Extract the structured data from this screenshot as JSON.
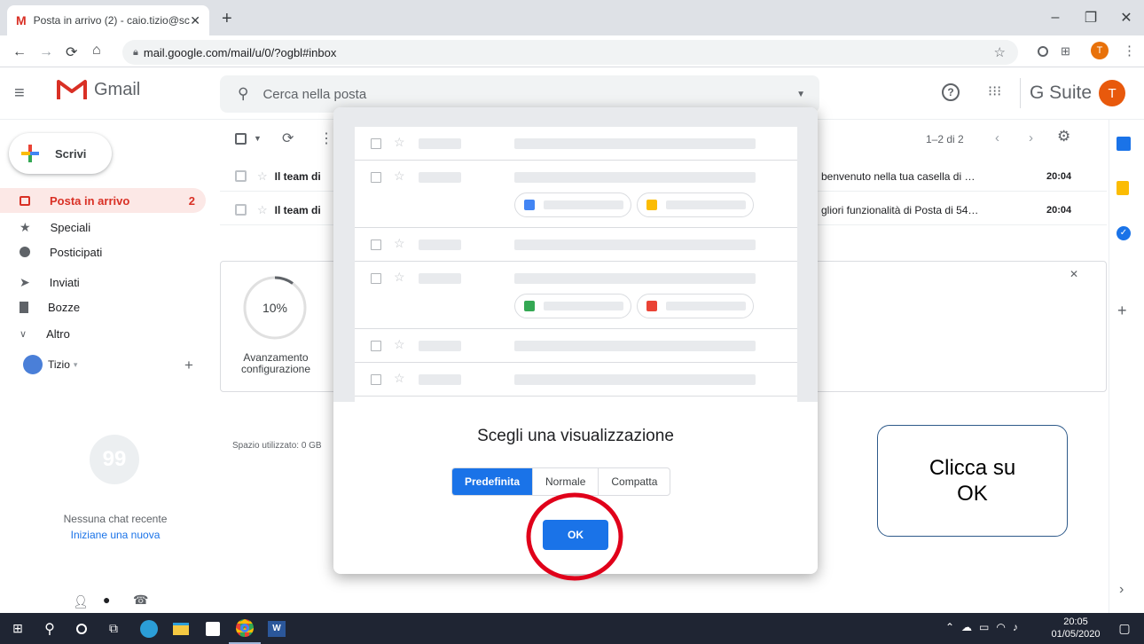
{
  "browser": {
    "tab_title": "Posta in arrivo (2) - caio.tizio@sc",
    "url": "mail.google.com/mail/u/0/?ogbl#inbox"
  },
  "gmail": {
    "logo_text": "Gmail",
    "search_placeholder": "Cerca nella posta",
    "gsuite": "G Suite",
    "avatar_letter": "T"
  },
  "sidebar": {
    "compose": "Scrivi",
    "items": [
      {
        "label": "Posta in arrivo",
        "count": "2"
      },
      {
        "label": "Speciali"
      },
      {
        "label": "Posticipati"
      },
      {
        "label": "Inviati"
      },
      {
        "label": "Bozze"
      },
      {
        "label": "Altro"
      }
    ],
    "hangouts_user": "Tizio",
    "no_chat": "Nessuna chat recente",
    "start_new": "Iniziane una nuova"
  },
  "toolbar": {
    "pagination": "1–2 di 2"
  },
  "mails": [
    {
      "sender": "Il team di",
      "snippet": "benvenuto nella tua casella di …",
      "time": "20:04"
    },
    {
      "sender": "Il team di",
      "snippet": "gliori funzionalità di Posta di 54…",
      "time": "20:04"
    }
  ],
  "setup": {
    "progress_label": "10%",
    "progress_value": 0.1,
    "caption_line1": "Avanzamento",
    "caption_line2": "configurazione",
    "storage": "Spazio utilizzato: 0 GB"
  },
  "modal": {
    "title": "Scegli una visualizzazione",
    "options": [
      "Predefinita",
      "Normale",
      "Compatta"
    ],
    "selected": "Predefinita",
    "ok": "OK"
  },
  "callout": {
    "line1": "Clicca su",
    "line2": "OK"
  },
  "taskbar": {
    "time": "20:05",
    "date": "01/05/2020"
  },
  "colors": {
    "accent": "#1a73e8",
    "gmail_red": "#d93025",
    "annotation_red": "#e0001a"
  }
}
